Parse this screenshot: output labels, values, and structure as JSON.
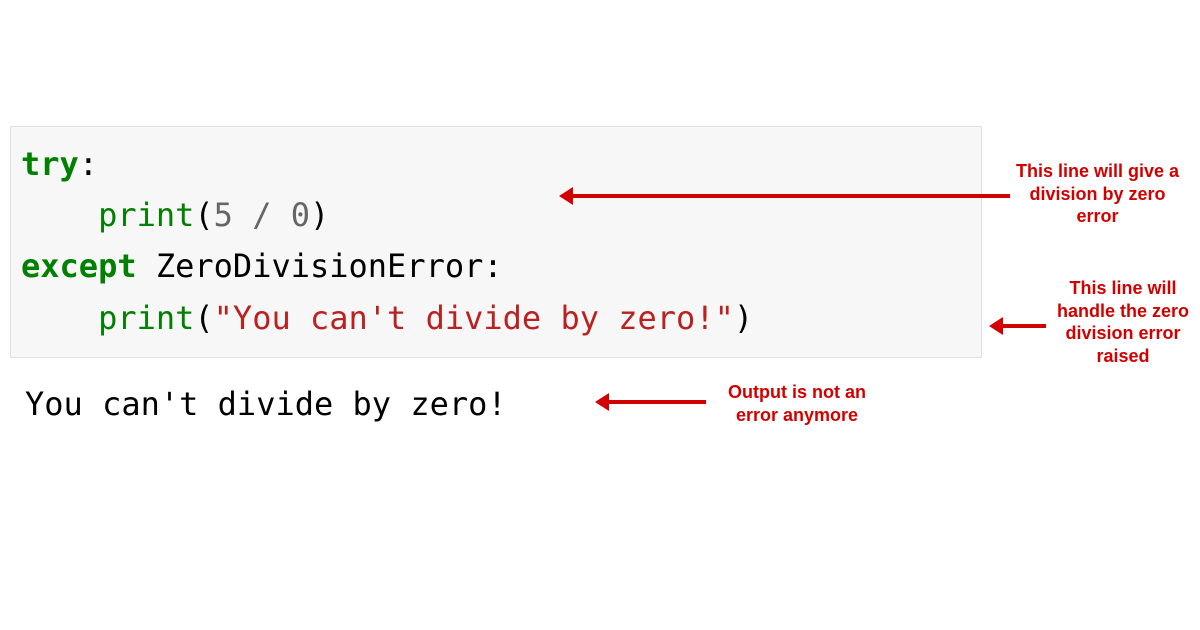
{
  "code": {
    "line1": {
      "kw": "try",
      "colon": ":"
    },
    "line2": {
      "indent": "    ",
      "fn": "print",
      "lparen": "(",
      "left": "5",
      "sp1": " ",
      "op": "/",
      "sp2": " ",
      "right": "0",
      "rparen": ")"
    },
    "line3": {
      "kw": "except",
      "sp": " ",
      "ident": "ZeroDivisionError",
      "colon": ":"
    },
    "line4": {
      "indent": "    ",
      "fn": "print",
      "lparen": "(",
      "str": "\"You can't divide by zero!\"",
      "rparen": ")"
    }
  },
  "output": "You can't divide by zero!",
  "annotations": {
    "a1": "This line will give a division by zero error",
    "a2": "This line will handle the zero division error raised",
    "a3": "Output is not an error anymore"
  },
  "colors": {
    "keyword": "#008000",
    "string": "#BA2121",
    "annotation": "#d30000",
    "codeBg": "#f7f7f7"
  }
}
